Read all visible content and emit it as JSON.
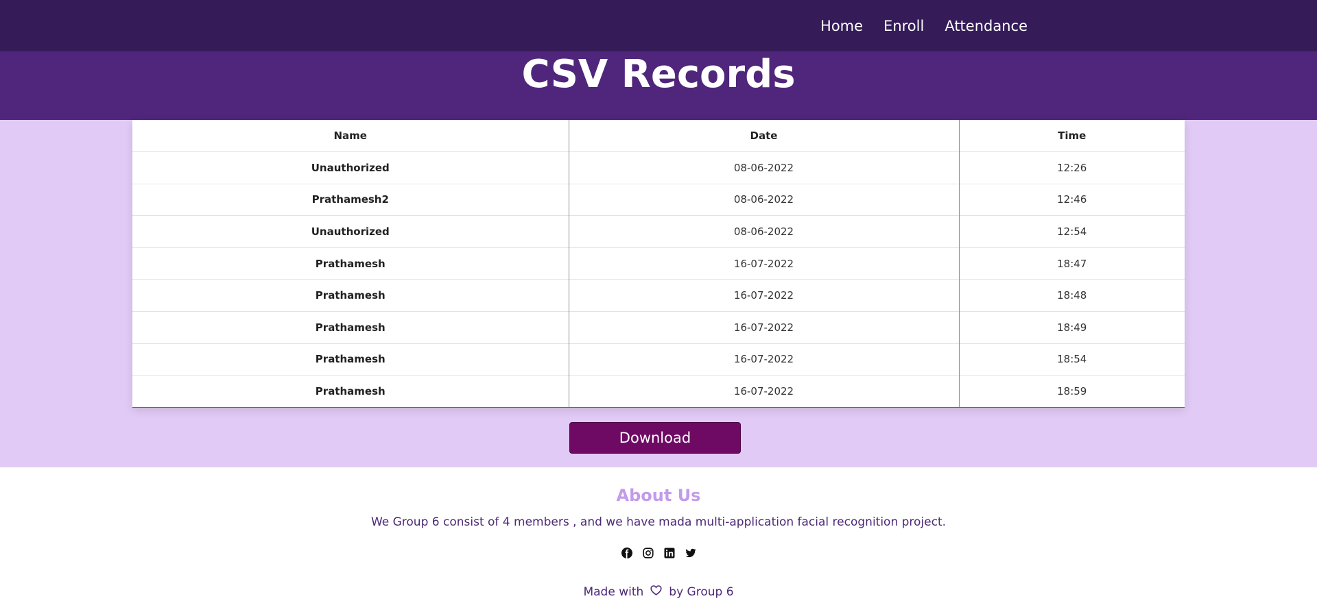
{
  "nav": {
    "links": [
      "Home",
      "Enroll",
      "Attendance"
    ]
  },
  "hero": {
    "title": "CSV Records"
  },
  "table": {
    "headers": [
      "Name",
      "Date",
      "Time"
    ],
    "rows": [
      [
        "Unauthorized",
        "08-06-2022",
        "12:26"
      ],
      [
        "Prathamesh2",
        "08-06-2022",
        "12:46"
      ],
      [
        "Unauthorized",
        "08-06-2022",
        "12:54"
      ],
      [
        "Prathamesh",
        "16-07-2022",
        "18:47"
      ],
      [
        "Prathamesh",
        "16-07-2022",
        "18:48"
      ],
      [
        "Prathamesh",
        "16-07-2022",
        "18:49"
      ],
      [
        "Prathamesh",
        "16-07-2022",
        "18:54"
      ],
      [
        "Prathamesh",
        "16-07-2022",
        "18:59"
      ]
    ]
  },
  "download": {
    "label": "Download"
  },
  "footer": {
    "about_title": "About Us",
    "about_text": "We Group 6 consist of 4 members , and we have mada multi-application facial recognition project.",
    "social_icons": [
      "facebook-icon",
      "instagram-icon",
      "linkedin-icon",
      "twitter-icon"
    ],
    "made_with_prefix": "Made with",
    "made_with_suffix": "by Group 6"
  },
  "colors": {
    "navbar": "#351c59",
    "hero": "#4f267b",
    "content_bg": "#e1cbf6",
    "button": "#6e0a63",
    "about_title": "#c39bea",
    "footer_text": "#4d2a78"
  }
}
